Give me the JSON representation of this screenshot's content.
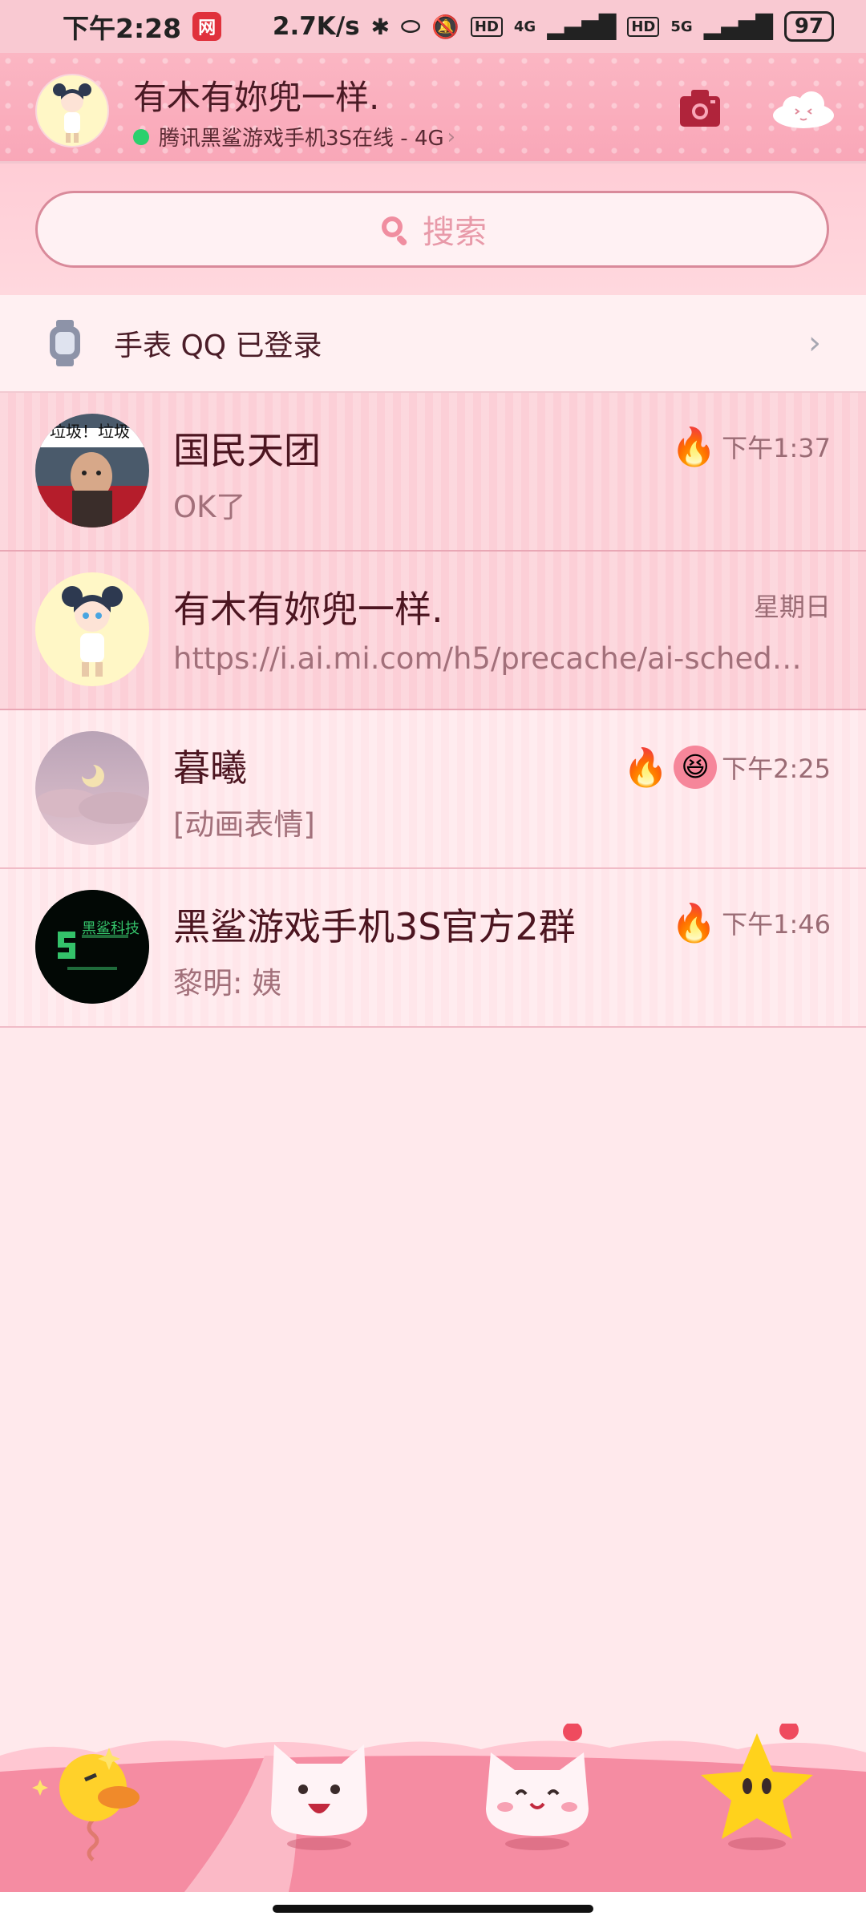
{
  "status_bar": {
    "time": "下午2:28",
    "netease_icon": "网",
    "network_speed": "2.7K/s",
    "signal_1": "4G",
    "signal_2": "5G",
    "hd_1": "HD",
    "hd_2": "HD",
    "battery": "97"
  },
  "header": {
    "nickname": "有木有妳兜一样.",
    "status_text": "腾讯黑鲨游戏手机3S在线 - 4G",
    "status_chevron": "›"
  },
  "search": {
    "placeholder": "搜索"
  },
  "watch_banner": {
    "text": "手表 QQ 已登录",
    "chevron": "›"
  },
  "chats": [
    {
      "name": "国民天团",
      "preview": "OK了",
      "time": "下午1:37",
      "badges": [
        "🔥"
      ],
      "avatar_caption": "垃圾！垃圾"
    },
    {
      "name": "有木有妳兜一样.",
      "preview": "https://i.ai.mi.com/h5/precache/ai-schedule/...",
      "time": "星期日",
      "badges": []
    },
    {
      "name": "暮曦",
      "preview": "[动画表情]",
      "time": "下午2:25",
      "badges": [
        "🔥",
        "😆"
      ]
    },
    {
      "name": "黑鲨游戏手机3S官方2群",
      "preview": "黎明: 姨",
      "time": "下午1:46",
      "badges": [
        "🔥"
      ],
      "avatar_caption": "黑鲨科技"
    }
  ],
  "tabs": [
    "message-tab",
    "contacts-tab",
    "qzone-tab",
    "favorites-tab"
  ],
  "colors": {
    "accent_pink": "#f9a7b8",
    "background": "#ffe9ec",
    "online": "#2bd06d",
    "badge_red": "#ef4b5e"
  }
}
